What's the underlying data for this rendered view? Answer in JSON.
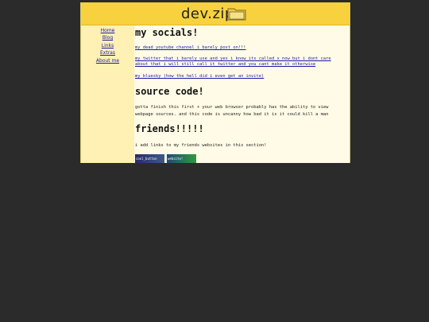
{
  "header": {
    "logo_text": "dev.zip",
    "logo_icon": "folder-icon"
  },
  "sidebar": {
    "items": [
      {
        "label": "Home"
      },
      {
        "label": "Blog"
      },
      {
        "label": "Links"
      },
      {
        "label": "Extras"
      },
      {
        "label": "About me"
      }
    ]
  },
  "main": {
    "socials": {
      "title": "my socials!",
      "links": [
        "my dead youtube channel i barely post on!!!",
        "my twitter that i barely use and yes i know its called x now but i dont care about that i will still call it twitter and you cant make it otherwise",
        "my bluesky (how the hell did i even get an invite)"
      ]
    },
    "source": {
      "title": "source code!",
      "text": "gotta finish this first + your web browser probably has the ability to view webpage sources. and this code is uncanny how bad it is it could kill a man"
    },
    "friends": {
      "title": "friends!!!!!",
      "text": "i add links to my friends websites in this section!",
      "badges": [
        "cool_button",
        "website!"
      ]
    }
  },
  "colors": {
    "header_bg": "#f7d23e",
    "sidebar_bg": "#fff0b3",
    "content_bg": "#fffbe6",
    "link": "#1a1aa8",
    "backdrop": "#2b2b2b"
  }
}
